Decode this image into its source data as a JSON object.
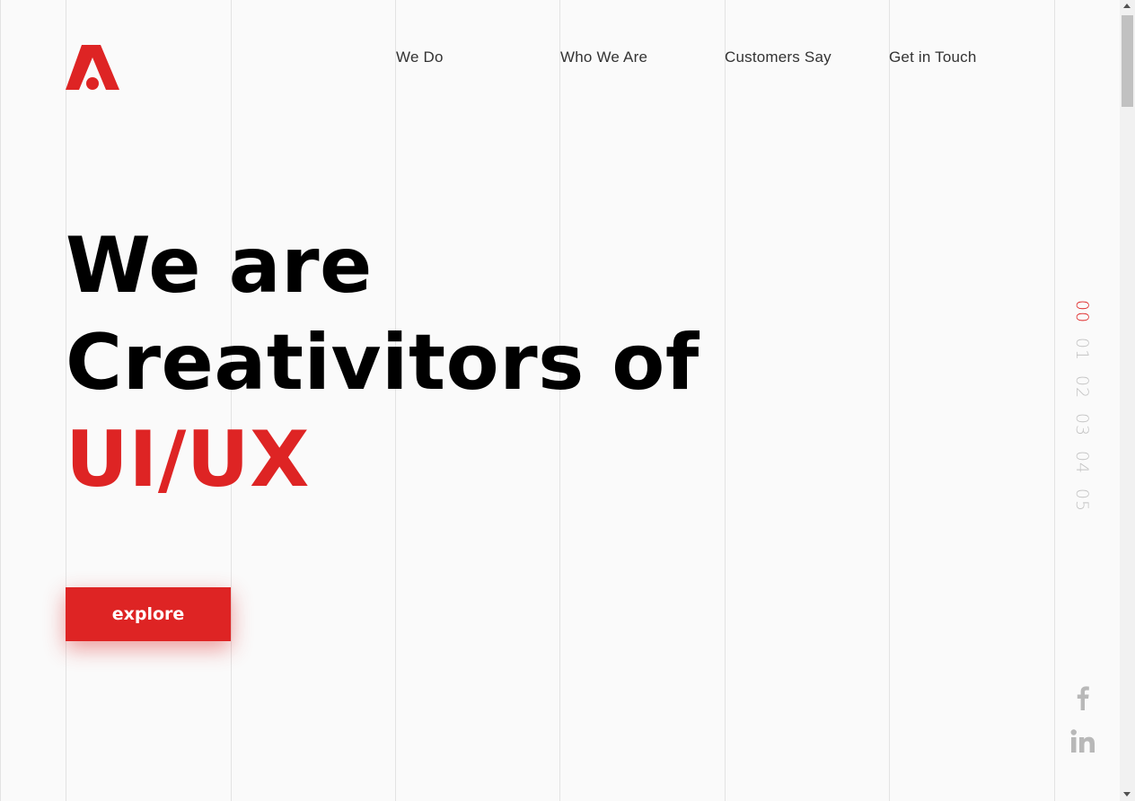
{
  "brand": {
    "logo_icon": "brand-a-logo-icon",
    "accent_color": "#de2424"
  },
  "nav": {
    "items": [
      {
        "label": "We Do"
      },
      {
        "label": "Who We Are"
      },
      {
        "label": "Customers Say"
      },
      {
        "label": "Get in Touch"
      }
    ]
  },
  "hero": {
    "line1": "We are",
    "line2": "Creativitors of",
    "line3": "UI/UX",
    "headline_color": "#000000",
    "highlight_color": "#de2424",
    "cta_label": "explore"
  },
  "pager": {
    "items": [
      "00",
      "01",
      "02",
      "03",
      "04",
      "05"
    ],
    "active": "00",
    "inactive_color": "#c4c4c4"
  },
  "social": {
    "items": [
      {
        "icon": "facebook-icon"
      },
      {
        "icon": "linkedin-icon"
      }
    ],
    "color": "#b8b8b8"
  }
}
